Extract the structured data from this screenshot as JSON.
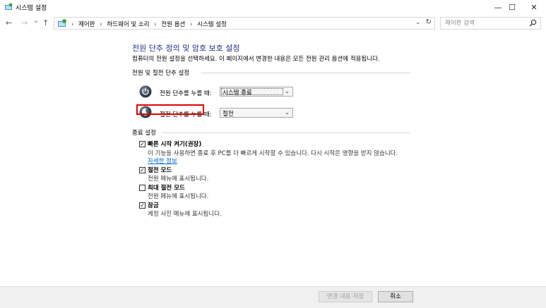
{
  "window": {
    "title": "시스템 설정",
    "minimize": "—",
    "maximize": "☐",
    "close": "✕"
  },
  "nav": {
    "back": "←",
    "forward": "→",
    "recent": "⌄",
    "up": "↑",
    "breadcrumb": [
      "제어판",
      "하드웨어 및 소리",
      "전원 옵션",
      "시스템 설정"
    ],
    "separator": "›",
    "dropdown": "⌄",
    "refresh": "↻"
  },
  "search": {
    "placeholder": "제어판 검색"
  },
  "main": {
    "title": "전원 단추 정의 및 암호 보호 설정",
    "description": "컴퓨터의 전원 설정을 선택하세요. 이 페이지에서 변경한 내용은 모든 전원 관리 옵션에 적용됩니다.",
    "power_section": "전원 및 절전 단추 설정",
    "power_button_label": "전원 단추를 누를 때:",
    "power_button_value": "시스템 종료",
    "sleep_button_label": "절전 단추를 누를 때:",
    "sleep_button_value": "절전",
    "shutdown_section": "종료 설정",
    "options": [
      {
        "label": "빠른 시작 켜기(권장)",
        "checked": true,
        "desc": "이 기능을 사용하면 종료 후 PC를 더 빠르게 시작할 수 있습니다. 다시 시작은 영향을 받지 않습니다.",
        "link": "자세한 정보"
      },
      {
        "label": "절전 모드",
        "checked": true,
        "desc": "전원 메뉴에 표시됩니다."
      },
      {
        "label": "최대 절전 모드",
        "checked": false,
        "desc": "전원 메뉴에 표시됩니다."
      },
      {
        "label": "잠금",
        "checked": true,
        "desc": "계정 사진 메뉴에 표시됩니다."
      }
    ]
  },
  "footer": {
    "save": "변경 내용 저장",
    "cancel": "취소"
  },
  "colors": {
    "title_blue": "#1e3287",
    "link_blue": "#0066cc",
    "highlight_red": "#e00000"
  }
}
